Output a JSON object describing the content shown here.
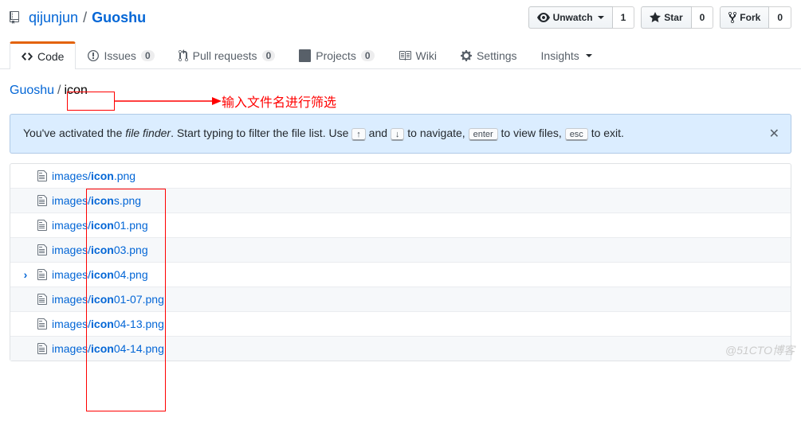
{
  "repo": {
    "owner": "qijunjun",
    "name": "Guoshu"
  },
  "actions": {
    "watch": {
      "label": "Unwatch",
      "count": "1"
    },
    "star": {
      "label": "Star",
      "count": "0"
    },
    "fork": {
      "label": "Fork",
      "count": "0"
    }
  },
  "tabs": {
    "code": "Code",
    "issues": {
      "label": "Issues",
      "count": "0"
    },
    "pulls": {
      "label": "Pull requests",
      "count": "0"
    },
    "projects": {
      "label": "Projects",
      "count": "0"
    },
    "wiki": "Wiki",
    "settings": "Settings",
    "insights": "Insights"
  },
  "finder": {
    "root": "Guoshu",
    "input_value": "icon",
    "hint_pre": "You've activated the ",
    "hint_em": "file finder",
    "hint_mid": ". Start typing to filter the file list. Use ",
    "key_up": "↑",
    "hint_and": " and ",
    "key_down": "↓",
    "hint_nav": " to navigate, ",
    "key_enter": "enter",
    "hint_view": " to view files, ",
    "key_esc": "esc",
    "hint_exit": " to exit."
  },
  "results": [
    {
      "prefix": "images/",
      "match": "icon",
      "suffix": ".png",
      "focus": false
    },
    {
      "prefix": "images/",
      "match": "icon",
      "suffix": "s.png",
      "focus": false
    },
    {
      "prefix": "images/",
      "match": "icon",
      "suffix": "01.png",
      "focus": false
    },
    {
      "prefix": "images/",
      "match": "icon",
      "suffix": "03.png",
      "focus": false
    },
    {
      "prefix": "images/",
      "match": "icon",
      "suffix": "04.png",
      "focus": true
    },
    {
      "prefix": "images/",
      "match": "icon",
      "suffix": "01-07.png",
      "focus": false
    },
    {
      "prefix": "images/",
      "match": "icon",
      "suffix": "04-13.png",
      "focus": false
    },
    {
      "prefix": "images/",
      "match": "icon",
      "suffix": "04-14.png",
      "focus": false
    }
  ],
  "annotation": {
    "text": "输入文件名进行筛选"
  },
  "watermark": "@51CTO博客"
}
